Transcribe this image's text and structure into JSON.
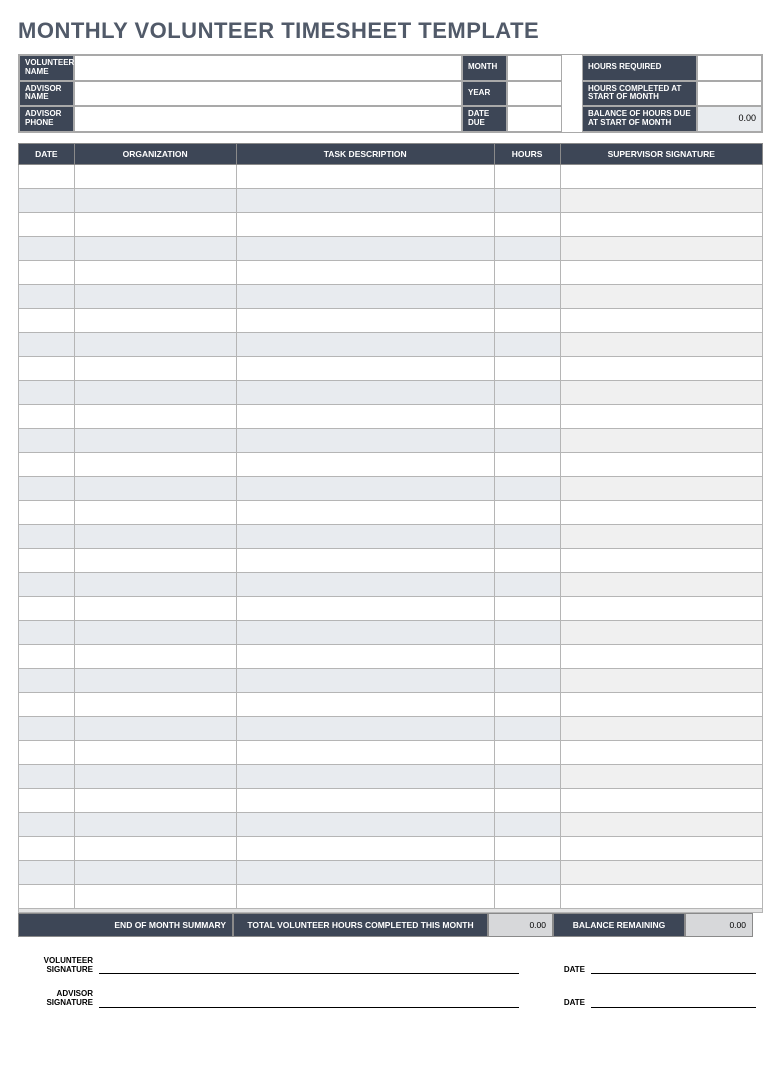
{
  "title": "MONTHLY VOLUNTEER TIMESHEET TEMPLATE",
  "header": {
    "vol_name_label": "VOLUNTEER NAME",
    "adv_name_label": "ADVISOR NAME",
    "adv_phone_label": "ADVISOR PHONE",
    "month_label": "MONTH",
    "year_label": "YEAR",
    "due_label": "DATE DUE",
    "hours_req_label": "HOURS REQUIRED",
    "hours_compl_label": "HOURS COMPLETED AT START OF MONTH",
    "balance_label": "BALANCE OF HOURS DUE AT START OF MONTH",
    "vol_name": "",
    "adv_name": "",
    "adv_phone": "",
    "month": "",
    "year": "",
    "due": "",
    "hours_req": "",
    "hours_compl": "",
    "balance": "0.00"
  },
  "cols": {
    "date": "DATE",
    "org": "ORGANIZATION",
    "task": "TASK DESCRIPTION",
    "hours": "HOURS",
    "sig": "SUPERVISOR SIGNATURE"
  },
  "rows_count": 31,
  "summary": {
    "eom_label": "END OF MONTH SUMMARY",
    "total_label": "TOTAL VOLUNTEER HOURS COMPLETED THIS MONTH",
    "total_val": "0.00",
    "bal_label": "BALANCE REMAINING",
    "bal_val": "0.00"
  },
  "footer": {
    "vol_sig_label": "VOLUNTEER SIGNATURE",
    "adv_sig_label": "ADVISOR SIGNATURE",
    "date_label": "DATE"
  }
}
